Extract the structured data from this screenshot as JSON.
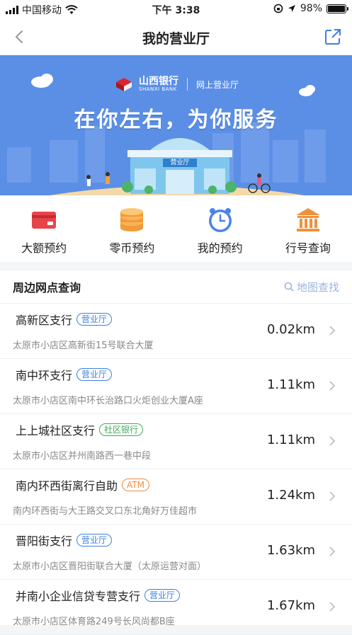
{
  "status_bar": {
    "carrier": "中国移动",
    "time": "下午 3:38",
    "battery": "98%",
    "battery_level": 0.98
  },
  "navbar": {
    "title": "我的营业厅",
    "back_icon": "chevron-left-icon",
    "share_icon": "external-link-icon"
  },
  "banner": {
    "bank_name": "山西银行",
    "bank_en": "SHANXI BANK",
    "online": "网上营业厅",
    "slogan": "在你左右，为你服务",
    "building_label": "营业厅",
    "colors": {
      "sky": "#5b8fe6",
      "ground": "#f4d9a8"
    }
  },
  "quick_actions": [
    {
      "label": "大额预约",
      "icon": "card-icon",
      "color": "#e8434a"
    },
    {
      "label": "零币预约",
      "icon": "coins-icon",
      "color": "#f29c38"
    },
    {
      "label": "我的预约",
      "icon": "clock-icon",
      "color": "#4a83e6"
    },
    {
      "label": "行号查询",
      "icon": "bank-building-icon",
      "color": "#f0913a"
    }
  ],
  "nearby": {
    "title": "周边网点查询",
    "map_search": "地图查找",
    "branches": [
      {
        "name": "高新区支行",
        "tag": "营业厅",
        "tag_color": "blue",
        "address": "太原市小店区高新街15号联合大厦",
        "distance": "0.02km"
      },
      {
        "name": "南中环支行",
        "tag": "营业厅",
        "tag_color": "blue",
        "address": "太原市小店区南中环长治路口火炬创业大厦A座",
        "distance": "1.11km"
      },
      {
        "name": "上上城社区支行",
        "tag": "社区银行",
        "tag_color": "green",
        "address": "太原市小店区并州南路西一巷中段",
        "distance": "1.11km"
      },
      {
        "name": "南内环西街离行自助",
        "tag": "ATM",
        "tag_color": "orange",
        "address": "南内环西街与大王路交叉口东北角好万佳超市",
        "distance": "1.24km"
      },
      {
        "name": "晋阳街支行",
        "tag": "营业厅",
        "tag_color": "blue",
        "address": "太原市小店区晋阳街联合大厦（太原运营对面）",
        "distance": "1.63km"
      },
      {
        "name": "并南小企业信贷专营支行",
        "tag": "营业厅",
        "tag_color": "blue",
        "address": "太原市小店区体育路249号长风尚都B座",
        "distance": "1.67km"
      }
    ]
  }
}
